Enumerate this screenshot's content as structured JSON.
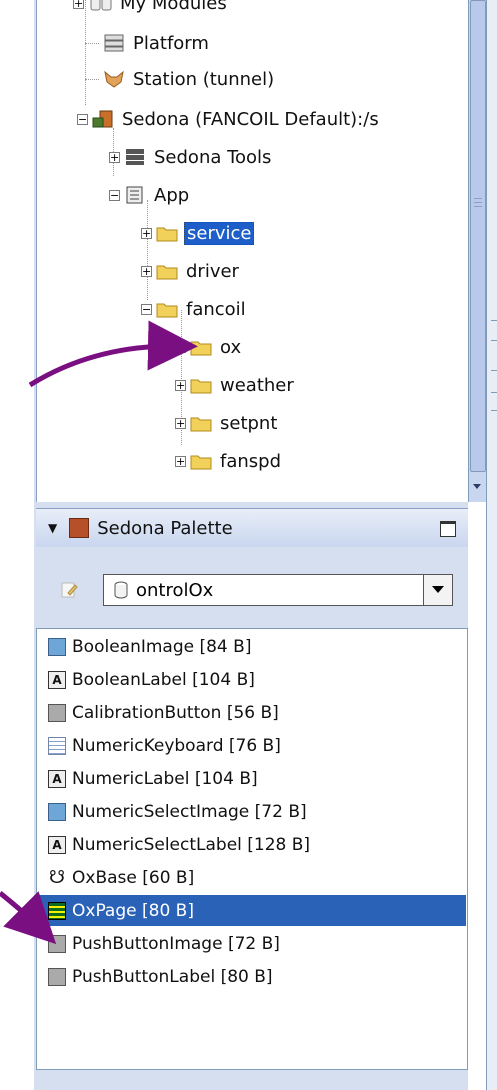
{
  "tree": {
    "nodes": [
      {
        "label": "My Modules",
        "icon": "modules-icon"
      },
      {
        "label": "Platform",
        "icon": "platform-icon"
      },
      {
        "label": "Station (tunnel)",
        "icon": "fox-icon"
      },
      {
        "label": "Sedona (FANCOIL Default):/s",
        "icon": "sedona-icon",
        "expander": "−"
      },
      {
        "label": "Sedona Tools",
        "icon": "tools-icon",
        "expander": "+"
      },
      {
        "label": "App",
        "icon": "app-icon",
        "expander": "−"
      },
      {
        "label": "service",
        "icon": "folder-icon",
        "expander": "+",
        "selected": true
      },
      {
        "label": "driver",
        "icon": "folder-icon",
        "expander": "+"
      },
      {
        "label": "fancoil",
        "icon": "folder-icon",
        "expander": "−"
      },
      {
        "label": "ox",
        "icon": "folder-icon",
        "expander": "+"
      },
      {
        "label": "weather",
        "icon": "folder-icon",
        "expander": "+"
      },
      {
        "label": "setpnt",
        "icon": "folder-icon",
        "expander": "+"
      },
      {
        "label": "fanspd",
        "icon": "folder-icon",
        "expander": "+"
      }
    ]
  },
  "palette": {
    "title": "Sedona Palette",
    "combo_value": "ontrolOx",
    "items": [
      {
        "label": "BooleanImage [84 B]",
        "icon": "image-icon"
      },
      {
        "label": "BooleanLabel [104 B]",
        "icon": "label-icon"
      },
      {
        "label": "CalibrationButton [56 B]",
        "icon": "button-icon"
      },
      {
        "label": "NumericKeyboard [76 B]",
        "icon": "keyboard-icon"
      },
      {
        "label": "NumericLabel [104 B]",
        "icon": "label-icon"
      },
      {
        "label": "NumericSelectImage [72 B]",
        "icon": "image-icon"
      },
      {
        "label": "NumericSelectLabel [128 B]",
        "icon": "label-icon"
      },
      {
        "label": "OxBase [60 B]",
        "icon": "oxbase-icon"
      },
      {
        "label": "OxPage [80 B]",
        "icon": "page-icon",
        "selected": true
      },
      {
        "label": "PushButtonImage [72 B]",
        "icon": "button-icon"
      },
      {
        "label": "PushButtonLabel [80 B]",
        "icon": "button-icon"
      }
    ]
  },
  "colors": {
    "selection": "#2a62b8",
    "arrow": "#7a0f82",
    "folder": "#f2d15a"
  }
}
